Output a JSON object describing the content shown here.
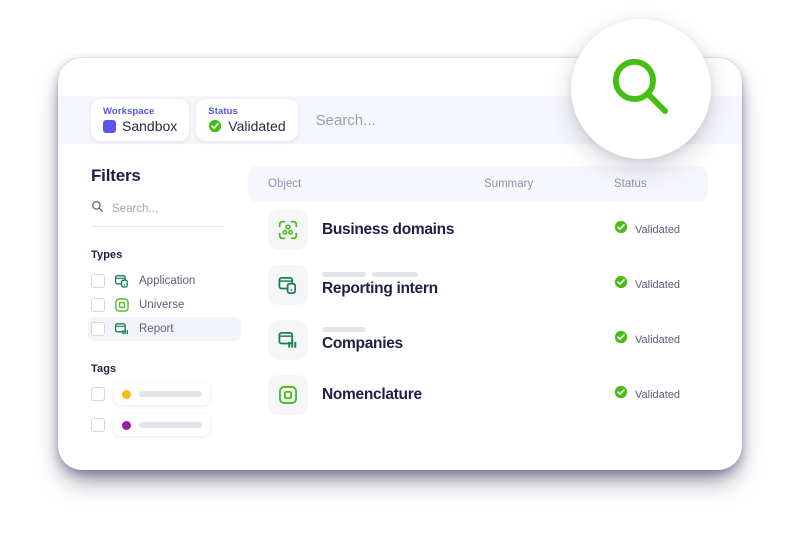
{
  "colors": {
    "accent_green": "#46be15",
    "dark_green": "#1a7f4b",
    "accent_purple": "#5b56ec",
    "label_blue": "#4f56e8",
    "navy_text": "#1c2045",
    "muted_text": "#8e91a8",
    "bar_gray": "#e2e5ec",
    "panel_bg": "#f6f7fc"
  },
  "topbar": {
    "workspace": {
      "label": "Workspace",
      "value": "Sandbox",
      "swatch_color": "#5b56ec",
      "icon": "color-swatch-icon"
    },
    "status": {
      "label": "Status",
      "value": "Validated",
      "icon": "check-circle-icon"
    },
    "search_placeholder": "Search..."
  },
  "sidebar": {
    "title": "Filters",
    "search_placeholder": "Search...",
    "search_icon": "search-icon",
    "groups": [
      {
        "title": "Types",
        "items": [
          {
            "label": "Application",
            "icon": "application-icon",
            "checked": false,
            "selected": false
          },
          {
            "label": "Universe",
            "icon": "universe-icon",
            "checked": false,
            "selected": false
          },
          {
            "label": "Report",
            "icon": "report-icon",
            "checked": false,
            "selected": true
          }
        ]
      },
      {
        "title": "Tags",
        "items": [
          {
            "label": "",
            "dot_color": "#f5b919",
            "checked": false
          },
          {
            "label": "",
            "dot_color": "#9c1ca8",
            "checked": false
          }
        ]
      }
    ]
  },
  "table": {
    "columns": [
      "Object",
      "Summary",
      "Status"
    ],
    "rows": [
      {
        "name": "Business domains",
        "icon": "scan-domains-icon",
        "icon_color": "#46be15",
        "tagline_bars": [],
        "summary_bar": true,
        "status": "Validated",
        "status_icon": "check-circle-icon"
      },
      {
        "name": "Reporting intern",
        "icon": "application-icon",
        "icon_color": "#1a7f4b",
        "tagline_bars": [
          44,
          46
        ],
        "summary_bar": true,
        "status": "Validated",
        "status_icon": "check-circle-icon"
      },
      {
        "name": "Companies",
        "icon": "report-icon",
        "icon_color": "#1a7f4b",
        "tagline_bars": [
          44
        ],
        "summary_bar": true,
        "status": "Validated",
        "status_icon": "check-circle-icon"
      },
      {
        "name": "Nomenclature",
        "icon": "universe-icon",
        "icon_color": "#46be15",
        "tagline_bars": [],
        "summary_bar": true,
        "status": "Validated",
        "status_icon": "check-circle-icon"
      }
    ]
  },
  "bubble": {
    "icon": "search-magnifier-icon",
    "icon_color": "#46be15"
  }
}
